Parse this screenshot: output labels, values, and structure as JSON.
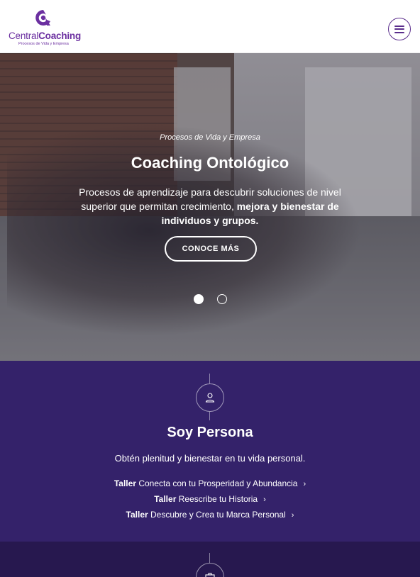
{
  "header": {
    "logo_central": "Central",
    "logo_coaching": "Coaching",
    "logo_tagline": "Procesos de Vida y Empresa",
    "menu_icon": "hamburger-menu-icon"
  },
  "hero": {
    "kicker": "Procesos de Vida y Empresa",
    "title": "Coaching Ontológico",
    "text_plain": "Procesos de aprendizaje para descubrir soluciones de nivel superior que permitan crecimiento, ",
    "text_bold": "mejora y bienestar de individuos y grupos.",
    "cta_label": "CONOCE MÁS",
    "slides": 2,
    "active_slide": 1
  },
  "persona": {
    "icon": "person-icon",
    "title_light": "Soy ",
    "title_bold": "Persona",
    "description": "Obtén plenitud y bienestar en tu vida personal.",
    "talleres": [
      {
        "prefix": "Taller",
        "name": "Conecta con tu Prosperidad y Abundancia"
      },
      {
        "prefix": "Taller",
        "name": "Reescribe tu Historia"
      },
      {
        "prefix": "Taller",
        "name": "Descubre y Crea tu Marca Personal"
      }
    ]
  },
  "next_section": {
    "icon": "briefcase-icon"
  },
  "colors": {
    "brand_purple": "#6b2fa0",
    "section_purple": "#34226a",
    "section_dark": "#27184f"
  }
}
